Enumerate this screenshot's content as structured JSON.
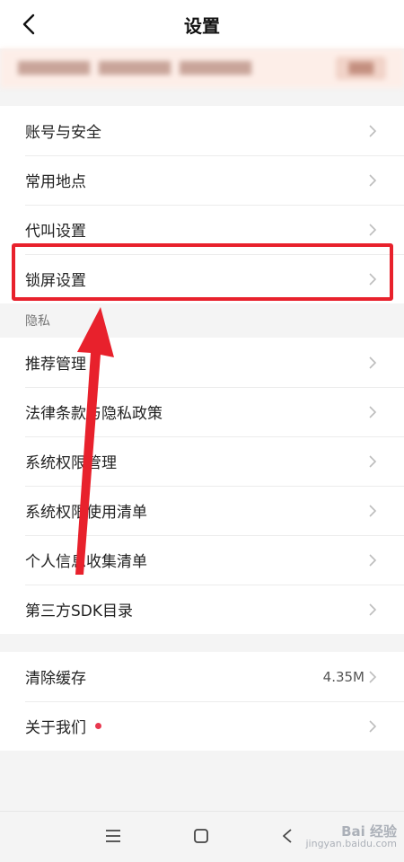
{
  "header": {
    "title": "设置"
  },
  "banner": {
    "texts": [
      "████████",
      "████████",
      "████████"
    ],
    "button": "███"
  },
  "group1": [
    {
      "label": "账号与安全"
    },
    {
      "label": "常用地点"
    },
    {
      "label": "代叫设置"
    },
    {
      "label": "锁屏设置"
    }
  ],
  "privacy": {
    "section_label": "隐私",
    "items": [
      {
        "label": "推荐管理"
      },
      {
        "label": "法律条款与隐私政策"
      },
      {
        "label": "系统权限管理"
      },
      {
        "label": "系统权限使用清单"
      },
      {
        "label": "个人信息收集清单"
      },
      {
        "label": "第三方SDK目录"
      }
    ]
  },
  "group3": [
    {
      "label": "清除缓存",
      "value": "4.35M"
    },
    {
      "label": "关于我们",
      "has_dot": true
    }
  ],
  "colors": {
    "highlight": "#e8212c",
    "dot": "#e8384f"
  },
  "watermark": {
    "main": "Bai 经验",
    "sub": "jingyan.baidu.com"
  }
}
